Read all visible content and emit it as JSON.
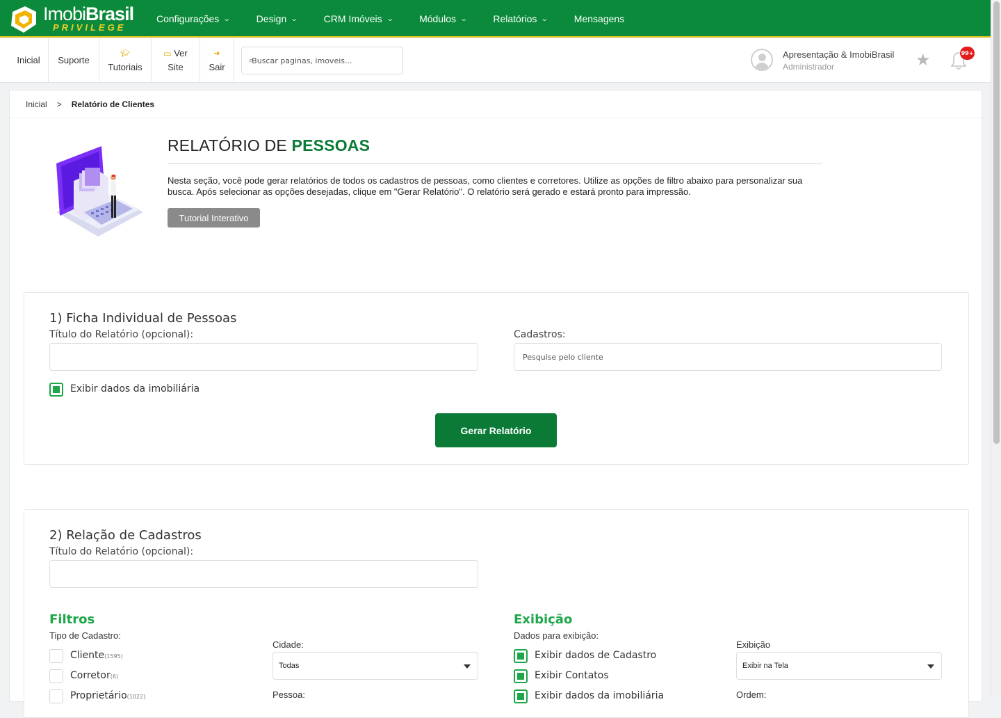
{
  "brand": {
    "logo_text_light": "Imobi",
    "logo_text_bold": "Brasil",
    "logo_sub": "PRIVILEGE",
    "primary_color": "#0a8a3a",
    "accent_color": "#f0cf2a"
  },
  "topnav": {
    "items": [
      {
        "label": "Configurações",
        "has_dropdown": true
      },
      {
        "label": "Design",
        "has_dropdown": true
      },
      {
        "label": "CRM Imóveis",
        "has_dropdown": true
      },
      {
        "label": "Módulos",
        "has_dropdown": true
      },
      {
        "label": "Relatórios",
        "has_dropdown": true
      },
      {
        "label": "Mensagens",
        "has_dropdown": false
      }
    ]
  },
  "subbar": {
    "inicial": "Inicial",
    "suporte": "Suporte",
    "tutoriais": "Tutoriais",
    "ver_site_1": "Ver",
    "ver_site_2": "Site",
    "sair": "Sair",
    "search_placeholder": "Buscar paginas, imoveis..."
  },
  "user": {
    "name": "Apresentação & ImobiBrasil",
    "role": "Administrador",
    "notifications": "99+"
  },
  "breadcrumb": {
    "home": "Inicial",
    "current": "Relatório de Clientes"
  },
  "header": {
    "title_prefix": "RELATÓRIO DE ",
    "title_highlight": "PESSOAS",
    "description": "Nesta seção, você pode gerar relatórios de todos os cadastros de pessoas, como clientes e corretores. Utilize as opções de filtro abaixo para personalizar sua busca. Após selecionar as opções desejadas, clique em \"Gerar Relatório\". O relatório será gerado e estará pronto para impressão.",
    "tutorial_button": "Tutorial Interativo"
  },
  "section1": {
    "title": "1) Ficha Individual de Pessoas",
    "titulo_label": "Título do Relatório (opcional):",
    "titulo_value": "",
    "cadastros_label": "Cadastros:",
    "cadastros_placeholder": "Pesquise pelo cliente",
    "exibir_imobiliaria_label": "Exibir dados da imobiliária",
    "exibir_imobiliaria_checked": true,
    "gerar_button": "Gerar Relatório"
  },
  "section2": {
    "title": "2) Relação de Cadastros",
    "titulo_label": "Título do Relatório (opcional):",
    "titulo_value": "",
    "filtros_heading": "Filtros",
    "tipo_label": "Tipo de Cadastro:",
    "tipos": [
      {
        "label": "Cliente",
        "count": "(1595)",
        "checked": false
      },
      {
        "label": "Corretor",
        "count": "(6)",
        "checked": false
      },
      {
        "label": "Proprietário",
        "count": "(1022)",
        "checked": false
      }
    ],
    "cidade_label": "Cidade:",
    "cidade_value": "Todas",
    "pessoa_label": "Pessoa:",
    "exibicao_heading": "Exibição",
    "dados_label": "Dados para exibição:",
    "dados": [
      {
        "label": "Exibir dados de Cadastro",
        "checked": true
      },
      {
        "label": "Exibir Contatos",
        "checked": true
      },
      {
        "label": "Exibir dados da imobiliária",
        "checked": true
      }
    ],
    "exibicao_select_label": "Exibição",
    "exibicao_select_value": "Exibir na Tela",
    "ordem_label": "Ordem:"
  }
}
